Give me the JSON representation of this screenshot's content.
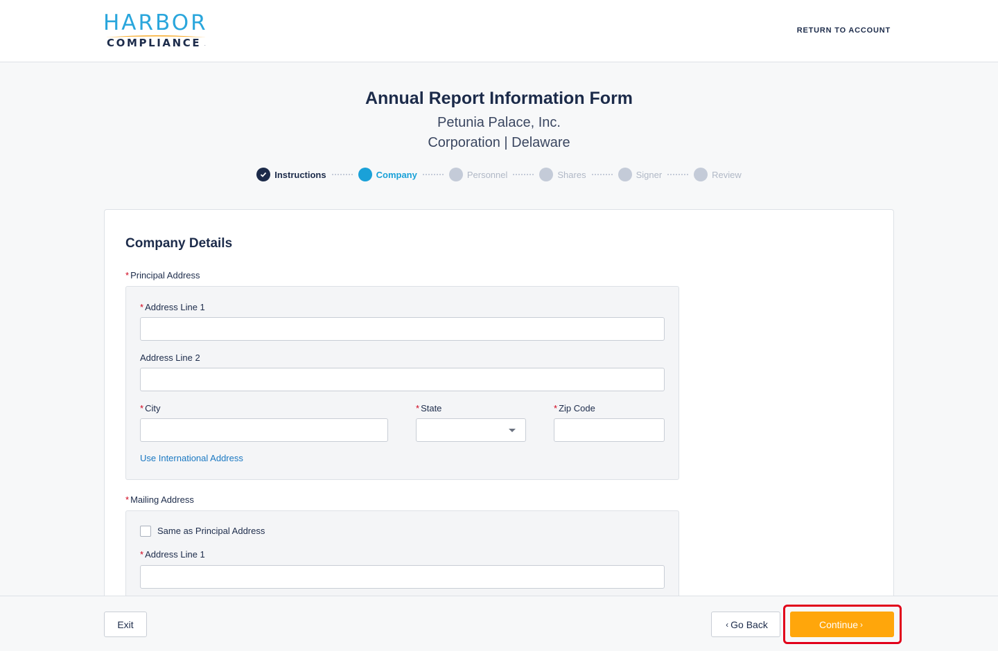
{
  "header": {
    "logo_top": "HARBOR",
    "logo_bottom": "COMPLIANCE",
    "logo_reg": ".",
    "return_link": "RETURN TO ACCOUNT"
  },
  "form": {
    "title": "Annual Report Information Form",
    "company_name": "Petunia Palace, Inc.",
    "entity_info": "Corporation | Delaware"
  },
  "stepper": {
    "steps": [
      {
        "label": "Instructions",
        "status": "done"
      },
      {
        "label": "Company",
        "status": "current"
      },
      {
        "label": "Personnel",
        "status": "upcoming"
      },
      {
        "label": "Shares",
        "status": "upcoming"
      },
      {
        "label": "Signer",
        "status": "upcoming"
      },
      {
        "label": "Review",
        "status": "upcoming"
      }
    ]
  },
  "company_details": {
    "section_title": "Company Details",
    "principal_address": {
      "label": "Principal Address",
      "address_line_1": {
        "label": "Address Line 1",
        "value": ""
      },
      "address_line_2": {
        "label": "Address Line 2",
        "value": ""
      },
      "city": {
        "label": "City",
        "value": ""
      },
      "state": {
        "label": "State",
        "value": ""
      },
      "zip": {
        "label": "Zip Code",
        "value": ""
      },
      "international_link": "Use International Address"
    },
    "mailing_address": {
      "label": "Mailing Address",
      "same_as_principal": {
        "label": "Same as Principal Address",
        "checked": false
      },
      "address_line_1": {
        "label": "Address Line 1",
        "value": ""
      }
    }
  },
  "footer": {
    "exit_label": "Exit",
    "back_label": "Go Back",
    "continue_label": "Continue"
  },
  "colors": {
    "primary_navy": "#1c2b4a",
    "accent_blue": "#1aa1d8",
    "continue_orange": "#ffa60b",
    "required_red": "#d0021b",
    "highlight_red": "#e1001a"
  }
}
